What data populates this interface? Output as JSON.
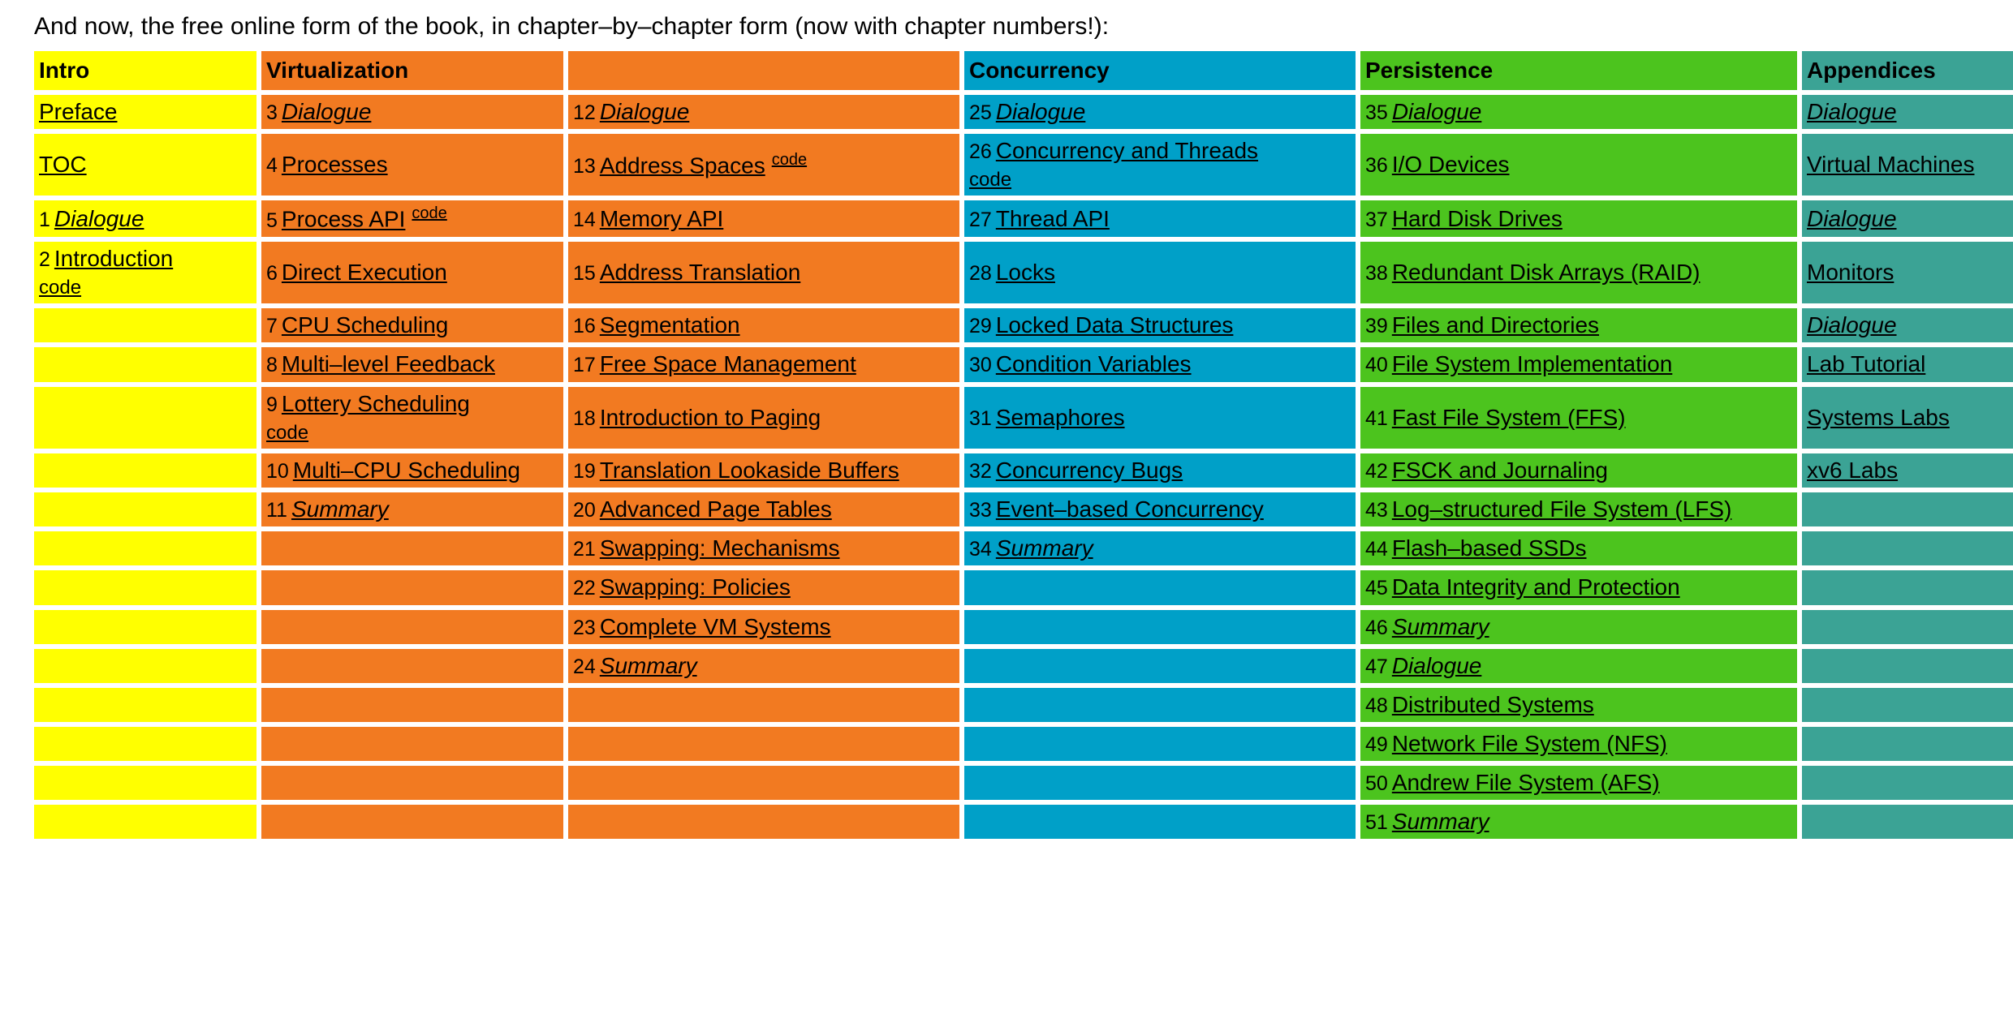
{
  "caption": "And now, the free online form of the book, in chapter–by–chapter form (now with chapter numbers!):",
  "colors": {
    "intro": "#ffff00",
    "virtualization": "#f27a21",
    "concurrency": "#00a0c8",
    "persistence": "#4cc41e",
    "appendices": "#3ba395",
    "text": "#000000",
    "background": "#ffffff"
  },
  "headers": {
    "intro": "Intro",
    "virtualization": "Virtualization",
    "virtualization2": "",
    "concurrency": "Concurrency",
    "persistence": "Persistence",
    "appendices": "Appendices"
  },
  "code_label": "code",
  "rows": [
    {
      "intro": {
        "num": "",
        "title": "Preface",
        "style": "plain",
        "code": "none"
      },
      "virt1": {
        "num": "3",
        "title": "Dialogue",
        "style": "italic",
        "code": "none"
      },
      "virt2": {
        "num": "12",
        "title": "Dialogue",
        "style": "italic",
        "code": "none"
      },
      "conc": {
        "num": "25",
        "title": "Dialogue",
        "style": "italic",
        "code": "none"
      },
      "pers": {
        "num": "35",
        "title": "Dialogue",
        "style": "italic",
        "code": "none"
      },
      "app": {
        "num": "",
        "title": "Dialogue",
        "style": "italic",
        "code": "none"
      }
    },
    {
      "intro": {
        "num": "",
        "title": "TOC",
        "style": "plain",
        "code": "none"
      },
      "virt1": {
        "num": "4",
        "title": "Processes",
        "style": "plain",
        "code": "none"
      },
      "virt2": {
        "num": "13",
        "title": "Address Spaces",
        "style": "plain",
        "code": "sup"
      },
      "conc": {
        "num": "26",
        "title": "Concurrency and Threads",
        "style": "plain",
        "code": "block"
      },
      "pers": {
        "num": "36",
        "title": "I/O Devices",
        "style": "plain",
        "code": "none"
      },
      "app": {
        "num": "",
        "title": "Virtual Machines",
        "style": "plain",
        "code": "none"
      }
    },
    {
      "intro": {
        "num": "1",
        "title": "Dialogue",
        "style": "italic",
        "code": "none"
      },
      "virt1": {
        "num": "5",
        "title": "Process API",
        "style": "plain",
        "code": "sup"
      },
      "virt2": {
        "num": "14",
        "title": "Memory API",
        "style": "plain",
        "code": "none"
      },
      "conc": {
        "num": "27",
        "title": "Thread API",
        "style": "plain",
        "code": "none"
      },
      "pers": {
        "num": "37",
        "title": "Hard Disk Drives",
        "style": "plain",
        "code": "none"
      },
      "app": {
        "num": "",
        "title": "Dialogue",
        "style": "italic",
        "code": "none"
      }
    },
    {
      "intro": {
        "num": "2",
        "title": "Introduction",
        "style": "plain",
        "code": "block"
      },
      "virt1": {
        "num": "6",
        "title": "Direct Execution",
        "style": "plain",
        "code": "none"
      },
      "virt2": {
        "num": "15",
        "title": "Address Translation",
        "style": "plain",
        "code": "none"
      },
      "conc": {
        "num": "28",
        "title": "Locks",
        "style": "plain",
        "code": "none"
      },
      "pers": {
        "num": "38",
        "title": "Redundant Disk Arrays (RAID)",
        "style": "plain",
        "code": "none"
      },
      "app": {
        "num": "",
        "title": "Monitors",
        "style": "plain",
        "code": "none"
      }
    },
    {
      "intro": {
        "num": "",
        "title": "",
        "style": "plain",
        "code": "none"
      },
      "virt1": {
        "num": "7",
        "title": "CPU Scheduling",
        "style": "plain",
        "code": "none"
      },
      "virt2": {
        "num": "16",
        "title": "Segmentation",
        "style": "plain",
        "code": "none"
      },
      "conc": {
        "num": "29",
        "title": "Locked Data Structures",
        "style": "plain",
        "code": "none"
      },
      "pers": {
        "num": "39",
        "title": "Files and Directories",
        "style": "plain",
        "code": "none"
      },
      "app": {
        "num": "",
        "title": "Dialogue",
        "style": "italic",
        "code": "none"
      }
    },
    {
      "intro": {
        "num": "",
        "title": "",
        "style": "plain",
        "code": "none"
      },
      "virt1": {
        "num": "8",
        "title": "Multi–level Feedback",
        "style": "plain",
        "code": "none"
      },
      "virt2": {
        "num": "17",
        "title": "Free Space Management",
        "style": "plain",
        "code": "none"
      },
      "conc": {
        "num": "30",
        "title": "Condition Variables",
        "style": "plain",
        "code": "none"
      },
      "pers": {
        "num": "40",
        "title": "File System Implementation",
        "style": "plain",
        "code": "none"
      },
      "app": {
        "num": "",
        "title": "Lab Tutorial",
        "style": "plain",
        "code": "none"
      }
    },
    {
      "intro": {
        "num": "",
        "title": "",
        "style": "plain",
        "code": "none"
      },
      "virt1": {
        "num": "9",
        "title": "Lottery Scheduling",
        "style": "plain",
        "code": "block"
      },
      "virt2": {
        "num": "18",
        "title": "Introduction to Paging",
        "style": "plain",
        "code": "none"
      },
      "conc": {
        "num": "31",
        "title": "Semaphores",
        "style": "plain",
        "code": "none"
      },
      "pers": {
        "num": "41",
        "title": "Fast File System (FFS)",
        "style": "plain",
        "code": "none"
      },
      "app": {
        "num": "",
        "title": "Systems Labs",
        "style": "plain",
        "code": "none"
      }
    },
    {
      "intro": {
        "num": "",
        "title": "",
        "style": "plain",
        "code": "none"
      },
      "virt1": {
        "num": "10",
        "title": "Multi–CPU Scheduling",
        "style": "plain",
        "code": "none"
      },
      "virt2": {
        "num": "19",
        "title": "Translation Lookaside Buffers",
        "style": "plain",
        "code": "none"
      },
      "conc": {
        "num": "32",
        "title": "Concurrency Bugs",
        "style": "plain",
        "code": "none"
      },
      "pers": {
        "num": "42",
        "title": "FSCK and Journaling",
        "style": "plain",
        "code": "none"
      },
      "app": {
        "num": "",
        "title": "xv6 Labs",
        "style": "plain",
        "code": "none"
      }
    },
    {
      "intro": {
        "num": "",
        "title": "",
        "style": "plain",
        "code": "none"
      },
      "virt1": {
        "num": "11",
        "title": "Summary",
        "style": "italic",
        "code": "none"
      },
      "virt2": {
        "num": "20",
        "title": "Advanced Page Tables",
        "style": "plain",
        "code": "none"
      },
      "conc": {
        "num": "33",
        "title": "Event–based Concurrency",
        "style": "plain",
        "code": "none"
      },
      "pers": {
        "num": "43",
        "title": "Log–structured File System (LFS)",
        "style": "plain",
        "code": "none"
      },
      "app": {
        "num": "",
        "title": "",
        "style": "plain",
        "code": "none"
      }
    },
    {
      "intro": {
        "num": "",
        "title": "",
        "style": "plain",
        "code": "none"
      },
      "virt1": {
        "num": "",
        "title": "",
        "style": "plain",
        "code": "none"
      },
      "virt2": {
        "num": "21",
        "title": "Swapping: Mechanisms",
        "style": "plain",
        "code": "none"
      },
      "conc": {
        "num": "34",
        "title": "Summary",
        "style": "italic",
        "code": "none"
      },
      "pers": {
        "num": "44",
        "title": "Flash–based SSDs",
        "style": "plain",
        "code": "none"
      },
      "app": {
        "num": "",
        "title": "",
        "style": "plain",
        "code": "none"
      }
    },
    {
      "intro": {
        "num": "",
        "title": "",
        "style": "plain",
        "code": "none"
      },
      "virt1": {
        "num": "",
        "title": "",
        "style": "plain",
        "code": "none"
      },
      "virt2": {
        "num": "22",
        "title": "Swapping: Policies",
        "style": "plain",
        "code": "none"
      },
      "conc": {
        "num": "",
        "title": "",
        "style": "plain",
        "code": "none"
      },
      "pers": {
        "num": "45",
        "title": "Data Integrity and Protection",
        "style": "plain",
        "code": "none"
      },
      "app": {
        "num": "",
        "title": "",
        "style": "plain",
        "code": "none"
      }
    },
    {
      "intro": {
        "num": "",
        "title": "",
        "style": "plain",
        "code": "none"
      },
      "virt1": {
        "num": "",
        "title": "",
        "style": "plain",
        "code": "none"
      },
      "virt2": {
        "num": "23",
        "title": "Complete VM Systems",
        "style": "plain",
        "code": "none"
      },
      "conc": {
        "num": "",
        "title": "",
        "style": "plain",
        "code": "none"
      },
      "pers": {
        "num": "46",
        "title": "Summary",
        "style": "italic",
        "code": "none"
      },
      "app": {
        "num": "",
        "title": "",
        "style": "plain",
        "code": "none"
      }
    },
    {
      "intro": {
        "num": "",
        "title": "",
        "style": "plain",
        "code": "none"
      },
      "virt1": {
        "num": "",
        "title": "",
        "style": "plain",
        "code": "none"
      },
      "virt2": {
        "num": "24",
        "title": "Summary",
        "style": "italic",
        "code": "none"
      },
      "conc": {
        "num": "",
        "title": "",
        "style": "plain",
        "code": "none"
      },
      "pers": {
        "num": "47",
        "title": "Dialogue",
        "style": "italic",
        "code": "none"
      },
      "app": {
        "num": "",
        "title": "",
        "style": "plain",
        "code": "none"
      }
    },
    {
      "intro": {
        "num": "",
        "title": "",
        "style": "plain",
        "code": "none"
      },
      "virt1": {
        "num": "",
        "title": "",
        "style": "plain",
        "code": "none"
      },
      "virt2": {
        "num": "",
        "title": "",
        "style": "plain",
        "code": "none"
      },
      "conc": {
        "num": "",
        "title": "",
        "style": "plain",
        "code": "none"
      },
      "pers": {
        "num": "48",
        "title": "Distributed Systems",
        "style": "plain",
        "code": "none"
      },
      "app": {
        "num": "",
        "title": "",
        "style": "plain",
        "code": "none"
      }
    },
    {
      "intro": {
        "num": "",
        "title": "",
        "style": "plain",
        "code": "none"
      },
      "virt1": {
        "num": "",
        "title": "",
        "style": "plain",
        "code": "none"
      },
      "virt2": {
        "num": "",
        "title": "",
        "style": "plain",
        "code": "none"
      },
      "conc": {
        "num": "",
        "title": "",
        "style": "plain",
        "code": "none"
      },
      "pers": {
        "num": "49",
        "title": "Network File System (NFS)",
        "style": "plain",
        "code": "none"
      },
      "app": {
        "num": "",
        "title": "",
        "style": "plain",
        "code": "none"
      }
    },
    {
      "intro": {
        "num": "",
        "title": "",
        "style": "plain",
        "code": "none"
      },
      "virt1": {
        "num": "",
        "title": "",
        "style": "plain",
        "code": "none"
      },
      "virt2": {
        "num": "",
        "title": "",
        "style": "plain",
        "code": "none"
      },
      "conc": {
        "num": "",
        "title": "",
        "style": "plain",
        "code": "none"
      },
      "pers": {
        "num": "50",
        "title": "Andrew File System (AFS)",
        "style": "plain",
        "code": "none"
      },
      "app": {
        "num": "",
        "title": "",
        "style": "plain",
        "code": "none"
      }
    },
    {
      "intro": {
        "num": "",
        "title": "",
        "style": "plain",
        "code": "none"
      },
      "virt1": {
        "num": "",
        "title": "",
        "style": "plain",
        "code": "none"
      },
      "virt2": {
        "num": "",
        "title": "",
        "style": "plain",
        "code": "none"
      },
      "conc": {
        "num": "",
        "title": "",
        "style": "plain",
        "code": "none"
      },
      "pers": {
        "num": "51",
        "title": "Summary",
        "style": "italic",
        "code": "none"
      },
      "app": {
        "num": "",
        "title": "",
        "style": "plain",
        "code": "none"
      }
    }
  ]
}
